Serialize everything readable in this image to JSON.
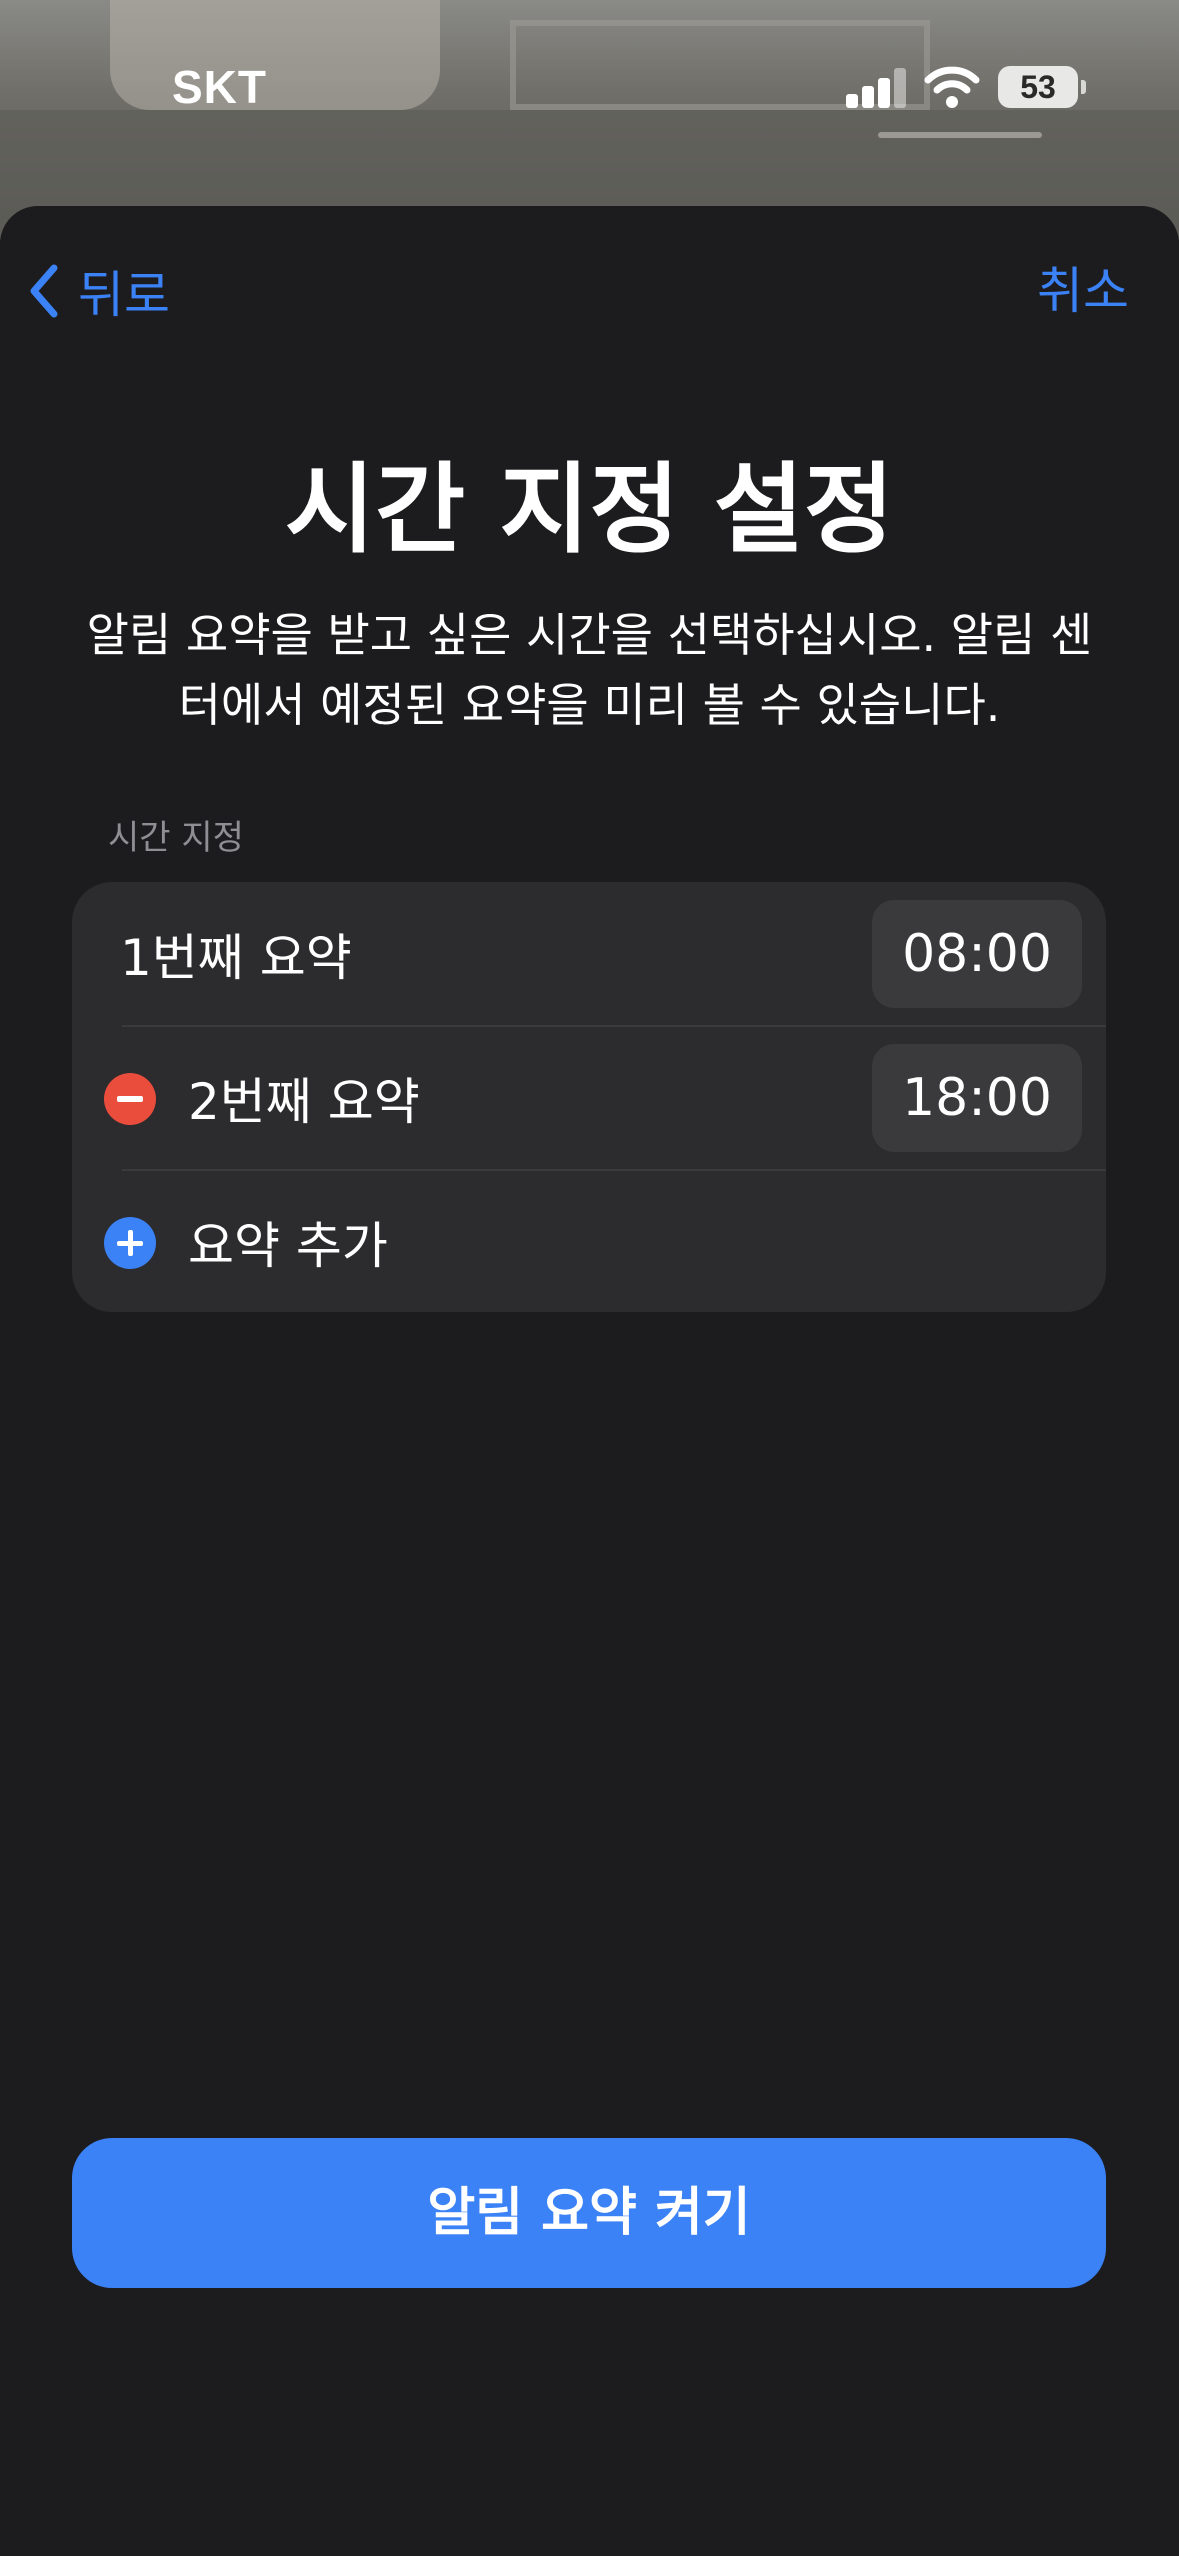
{
  "status_bar": {
    "carrier": "SKT",
    "battery_level": "53"
  },
  "nav": {
    "back_label": "뒤로",
    "cancel_label": "취소"
  },
  "header": {
    "title": "시간 지정 설정",
    "subtitle": "알림 요약을 받고 싶은 시간을 선택하십시오. 알림 센터에서 예정된 요약을 미리 볼 수 있습니다."
  },
  "schedule": {
    "section_label": "시간 지정",
    "items": [
      {
        "label": "1번째 요약",
        "time": "08:00"
      },
      {
        "label": "2번째 요약",
        "time": "18:00"
      }
    ],
    "add_label": "요약 추가"
  },
  "footer": {
    "primary_button_label": "알림 요약 켜기"
  },
  "colors": {
    "accent": "#3b82f6",
    "destructive": "#eb4d3d",
    "background": "#1c1c1e",
    "group_background": "#2c2c2e"
  }
}
